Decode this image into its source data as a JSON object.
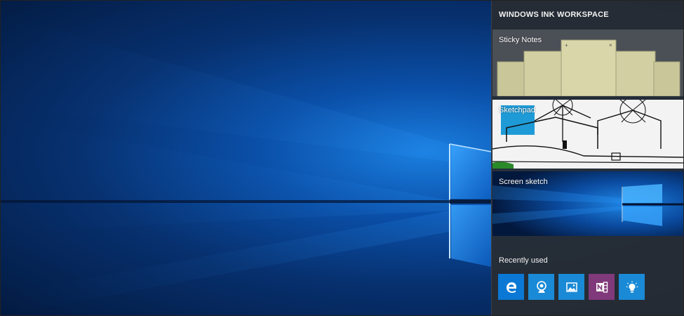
{
  "panel": {
    "title": "WINDOWS INK WORKSPACE"
  },
  "tiles": [
    {
      "label": "Sticky Notes"
    },
    {
      "label": "Sketchpad"
    },
    {
      "label": "Screen sketch"
    }
  ],
  "recent": {
    "label": "Recently used",
    "apps": [
      {
        "icon": "edge-icon",
        "color": "#0a78d4"
      },
      {
        "icon": "webcam-icon",
        "color": "#1a8ad6"
      },
      {
        "icon": "photos-icon",
        "color": "#1a8ad6"
      },
      {
        "icon": "onenote-icon",
        "color": "#80397b"
      },
      {
        "icon": "tips-icon",
        "color": "#1a8ad6"
      }
    ]
  },
  "colors": {
    "panel_bg": "#2a2e34",
    "sticky_note": "#d6d4a6",
    "accent_blue": "#1a8ad6"
  }
}
